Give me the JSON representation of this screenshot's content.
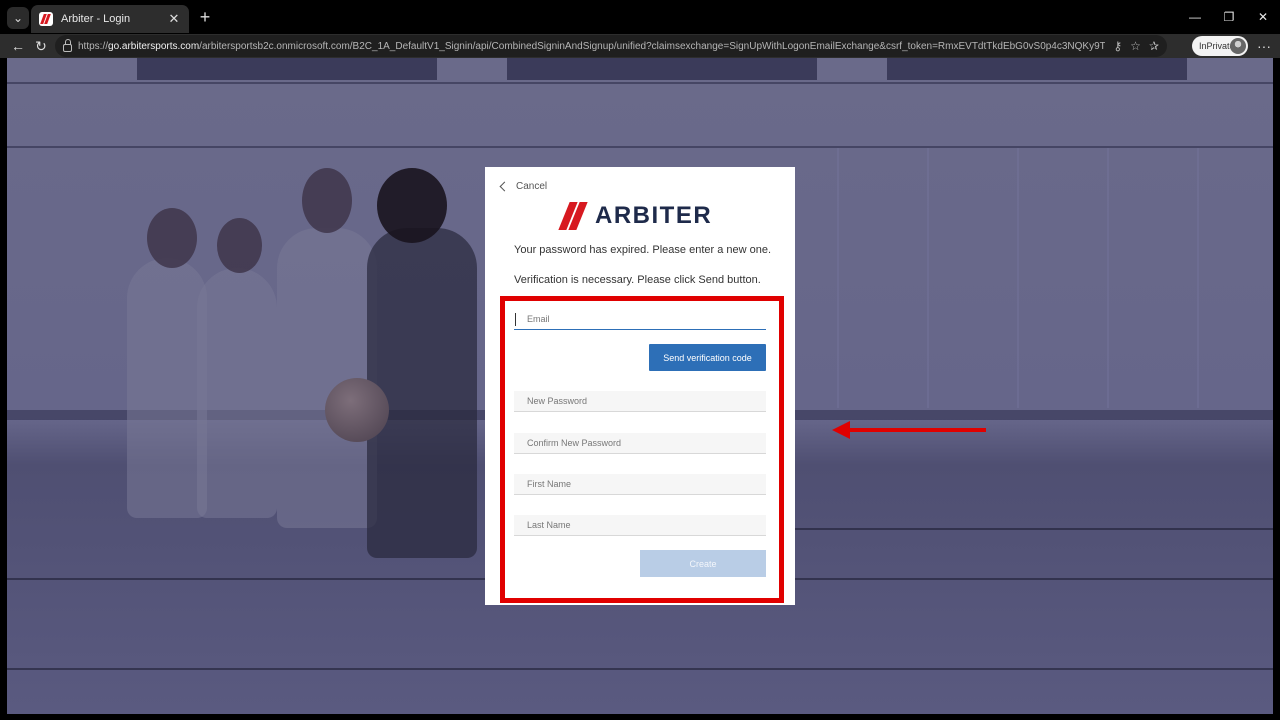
{
  "browser": {
    "tab_menu_icon": "chevron-down-icon",
    "tab_title": "Arbiter - Login",
    "tab_close": "✕",
    "new_tab": "+",
    "window_controls": {
      "minimize": "—",
      "maximize": "❐",
      "close": "✕"
    },
    "url_prefix": "https://",
    "url_host": "go.arbitersports.com",
    "url_path": "/arbitersportsb2c.onmicrosoft.com/B2C_1A_DefaultV1_Signin/api/CombinedSigninAndSignup/unified?claimsexchange=SignUpWithLogonEmailExchange&csrf_token=RmxEVTdtTkdEbG0vS0p4c3NQKy9TM2htWGxOTTdtM2JEMl...",
    "inprivate_label": "InPrivate",
    "more": "···"
  },
  "card": {
    "cancel_label": "Cancel",
    "logo_text": "ARBITER",
    "message_expired": "Your password has expired. Please enter a new one.",
    "message_verification": "Verification is necessary. Please click Send button.",
    "fields": {
      "email": "Email",
      "new_password": "New Password",
      "confirm_password": "Confirm New Password",
      "first_name": "First Name",
      "last_name": "Last Name"
    },
    "send_button": "Send verification code",
    "create_button": "Create"
  },
  "colors": {
    "brand_red": "#d71920",
    "primary_blue": "#2d6fb7",
    "disabled_blue": "#b9cde6",
    "annotation_red": "#e00000"
  }
}
